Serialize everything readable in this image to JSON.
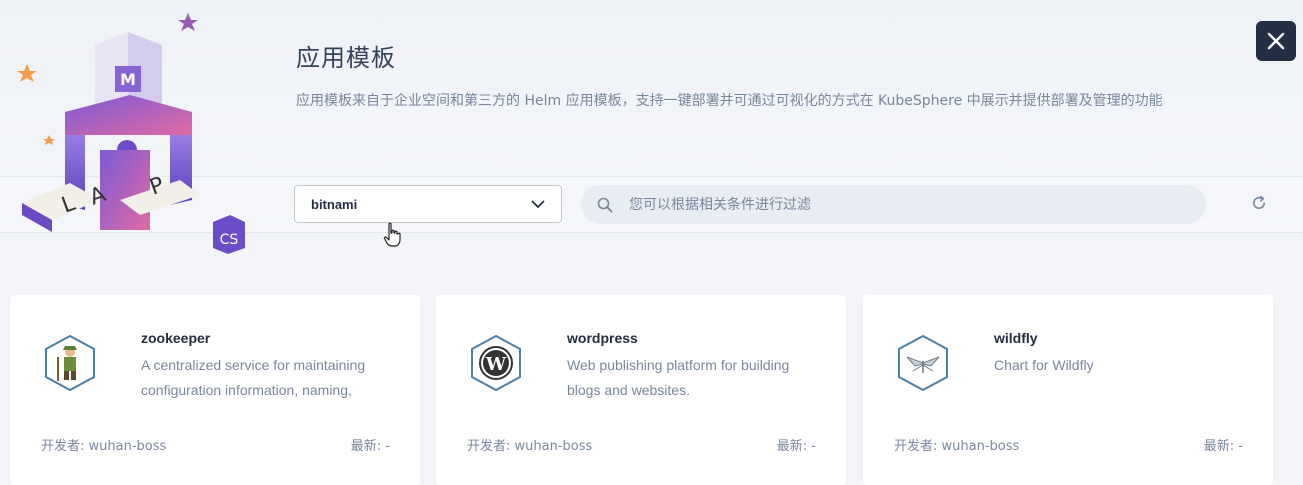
{
  "header": {
    "title": "应用模板",
    "description": "应用模板来自于企业空间和第三方的 Helm 应用模板，支持一键部署并可通过可视化的方式在 KubeSphere 中展示并提供部署及管理的功能"
  },
  "toolbar": {
    "repo_selected": "bitnami",
    "search_placeholder": "您可以根据相关条件进行过滤"
  },
  "hero": {
    "letters": [
      "L",
      "A",
      "P"
    ],
    "badge": "CS"
  },
  "apps": [
    {
      "name": "zookeeper",
      "description": "A centralized service for maintaining configuration information, naming,",
      "developer": "开发者: wuhan-boss",
      "latest": "最新: -",
      "icon": "zookeeper-icon"
    },
    {
      "name": "wordpress",
      "description": "Web publishing platform for building blogs and websites.",
      "developer": "开发者: wuhan-boss",
      "latest": "最新: -",
      "icon": "wordpress-icon"
    },
    {
      "name": "wildfly",
      "description": "Chart for Wildfly",
      "developer": "开发者: wuhan-boss",
      "latest": "最新: -",
      "icon": "wildfly-icon"
    }
  ],
  "colors": {
    "dark": "#242e42",
    "muted": "#79879c",
    "accent": "#7d4fd0"
  }
}
